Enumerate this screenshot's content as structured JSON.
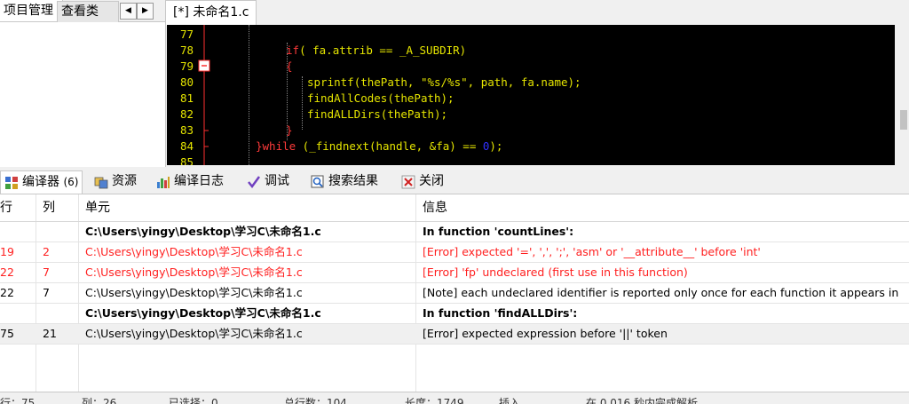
{
  "left_panel": {
    "tabs": [
      "项目管理",
      "查看类"
    ]
  },
  "editor": {
    "tab_label": "[*] 未命名1.c",
    "line_numbers": [
      "77",
      "78",
      "79",
      "80",
      "81",
      "82",
      "83",
      "84",
      "85"
    ],
    "lines": {
      "l78": {
        "kw": "if",
        "rest": "( fa.attrib == _A_SUBDIR)"
      },
      "l79": "{",
      "l80": {
        "fn": "sprintf",
        "pre": "(thePath, ",
        "str": "\"%s/%s\"",
        "post": ", path, fa.name);"
      },
      "l81": {
        "fn": "findAllCodes",
        "rest": "(thePath);"
      },
      "l82": {
        "fn": "findALLDirs",
        "rest": "(thePath);"
      },
      "l83": "}",
      "l84": {
        "kw1": "}while",
        "mid": " (_findnext(handle, &fa) == ",
        "num": "0",
        "end": ");"
      }
    }
  },
  "panel_tabs": [
    {
      "label": "编译器",
      "count": "(6)"
    },
    {
      "label": "资源"
    },
    {
      "label": "编译日志"
    },
    {
      "label": "调试"
    },
    {
      "label": "搜索结果"
    },
    {
      "label": "关闭"
    }
  ],
  "table": {
    "headers": [
      "行",
      "列",
      "单元",
      "信息"
    ],
    "rows": [
      {
        "line": "",
        "col": "",
        "unit": "C:\\Users\\yingy\\Desktop\\学习C\\未命名1.c",
        "message": "In function 'countLines':",
        "type": "bold"
      },
      {
        "line": "19",
        "col": "2",
        "unit": "C:\\Users\\yingy\\Desktop\\学习C\\未命名1.c",
        "message": "[Error] expected '=', ',', ';', 'asm' or '__attribute__' before 'int'",
        "type": "err"
      },
      {
        "line": "22",
        "col": "7",
        "unit": "C:\\Users\\yingy\\Desktop\\学习C\\未命名1.c",
        "message": "[Error] 'fp' undeclared (first use in this function)",
        "type": "err"
      },
      {
        "line": "22",
        "col": "7",
        "unit": "C:\\Users\\yingy\\Desktop\\学习C\\未命名1.c",
        "message": "[Note] each undeclared identifier is reported only once for each function it appears in",
        "type": "note"
      },
      {
        "line": "",
        "col": "",
        "unit": "C:\\Users\\yingy\\Desktop\\学习C\\未命名1.c",
        "message": "In function 'findALLDirs':",
        "type": "bold"
      },
      {
        "line": "75",
        "col": "21",
        "unit": "C:\\Users\\yingy\\Desktop\\学习C\\未命名1.c",
        "message": "[Error] expected expression before '||' token",
        "type": "sel"
      }
    ]
  },
  "status": {
    "line_label": "行：",
    "line_value": "75",
    "col_label": "列：",
    "col_value": "26",
    "sel_label": "已选择：",
    "sel_value": "0",
    "total_label": "总行数：",
    "total_value": "104",
    "len_label": "长度：",
    "len_value": "1749",
    "mode": "插入",
    "parse_msg": "在 0.016 秒内完成解析"
  },
  "colors": {
    "keyword": "#ff3a3a",
    "identifier": "#e5e500",
    "number": "#3030ff",
    "error_text": "#ff2020"
  }
}
